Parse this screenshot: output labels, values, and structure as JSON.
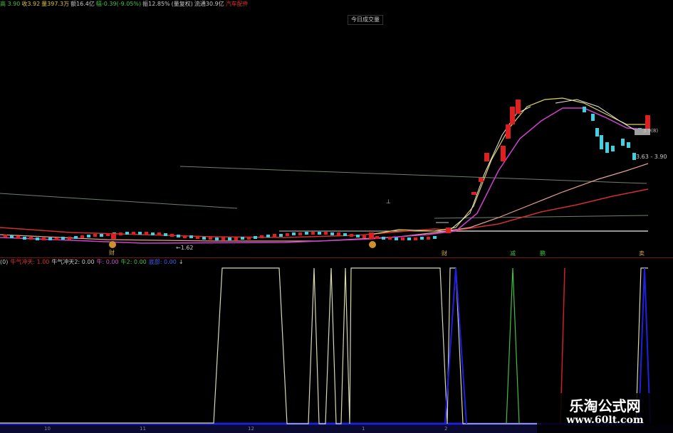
{
  "header": {
    "items": [
      {
        "text": "高 3.90",
        "color": "t-grn"
      },
      {
        "text": "收3.92",
        "color": "t-yel"
      },
      {
        "text": "量397.3万",
        "color": "t-yel"
      },
      {
        "text": "额16.4亿",
        "color": "t-wht"
      },
      {
        "text": "幅-0.39(-9.05%)",
        "color": "t-grn"
      },
      {
        "text": "振12.85%",
        "color": "t-wht"
      },
      {
        "text": "(量复权)",
        "color": "t-wht"
      },
      {
        "text": "流通30.9亿",
        "color": "t-wht"
      },
      {
        "text": "汽车配件",
        "color": "t-red"
      }
    ],
    "volume_button": "今日成交量"
  },
  "indicator": {
    "items": [
      {
        "text": "(0)",
        "color": "t-wht"
      },
      {
        "text": "牛气冲天: 1.00",
        "color": "t-red"
      },
      {
        "text": "牛气冲天2: 0.00",
        "color": "t-wht"
      },
      {
        "text": "牛: 0.00",
        "color": "t-mag"
      },
      {
        "text": "牛2: 0.00",
        "color": "t-grn"
      },
      {
        "text": "底部: 0.00",
        "color": "t-blu"
      },
      {
        "text": "↓",
        "color": "t-wht"
      }
    ]
  },
  "signals": {
    "cai1": "财",
    "cai2": "财",
    "jian": "减",
    "peng": "鹏",
    "mai": "卖",
    "dot": "⊥"
  },
  "price_labels": {
    "low": "←1.62",
    "range": "3.63 - 3.90",
    "right": "3.9(8)"
  },
  "dates": [
    "10",
    "11",
    "12",
    "1",
    "2"
  ],
  "watermark": {
    "title": "乐淘公式网",
    "url": "www.60lt.com"
  },
  "colors": {
    "up": "#e02020",
    "down": "#40d0e0",
    "ma5": "#e8e8e8",
    "ma10": "#e0d060",
    "ma20": "#d040d0",
    "ma60": "#c02020",
    "ind_yellow": "#d8d8b0",
    "ind_blue": "#2020e0"
  }
}
